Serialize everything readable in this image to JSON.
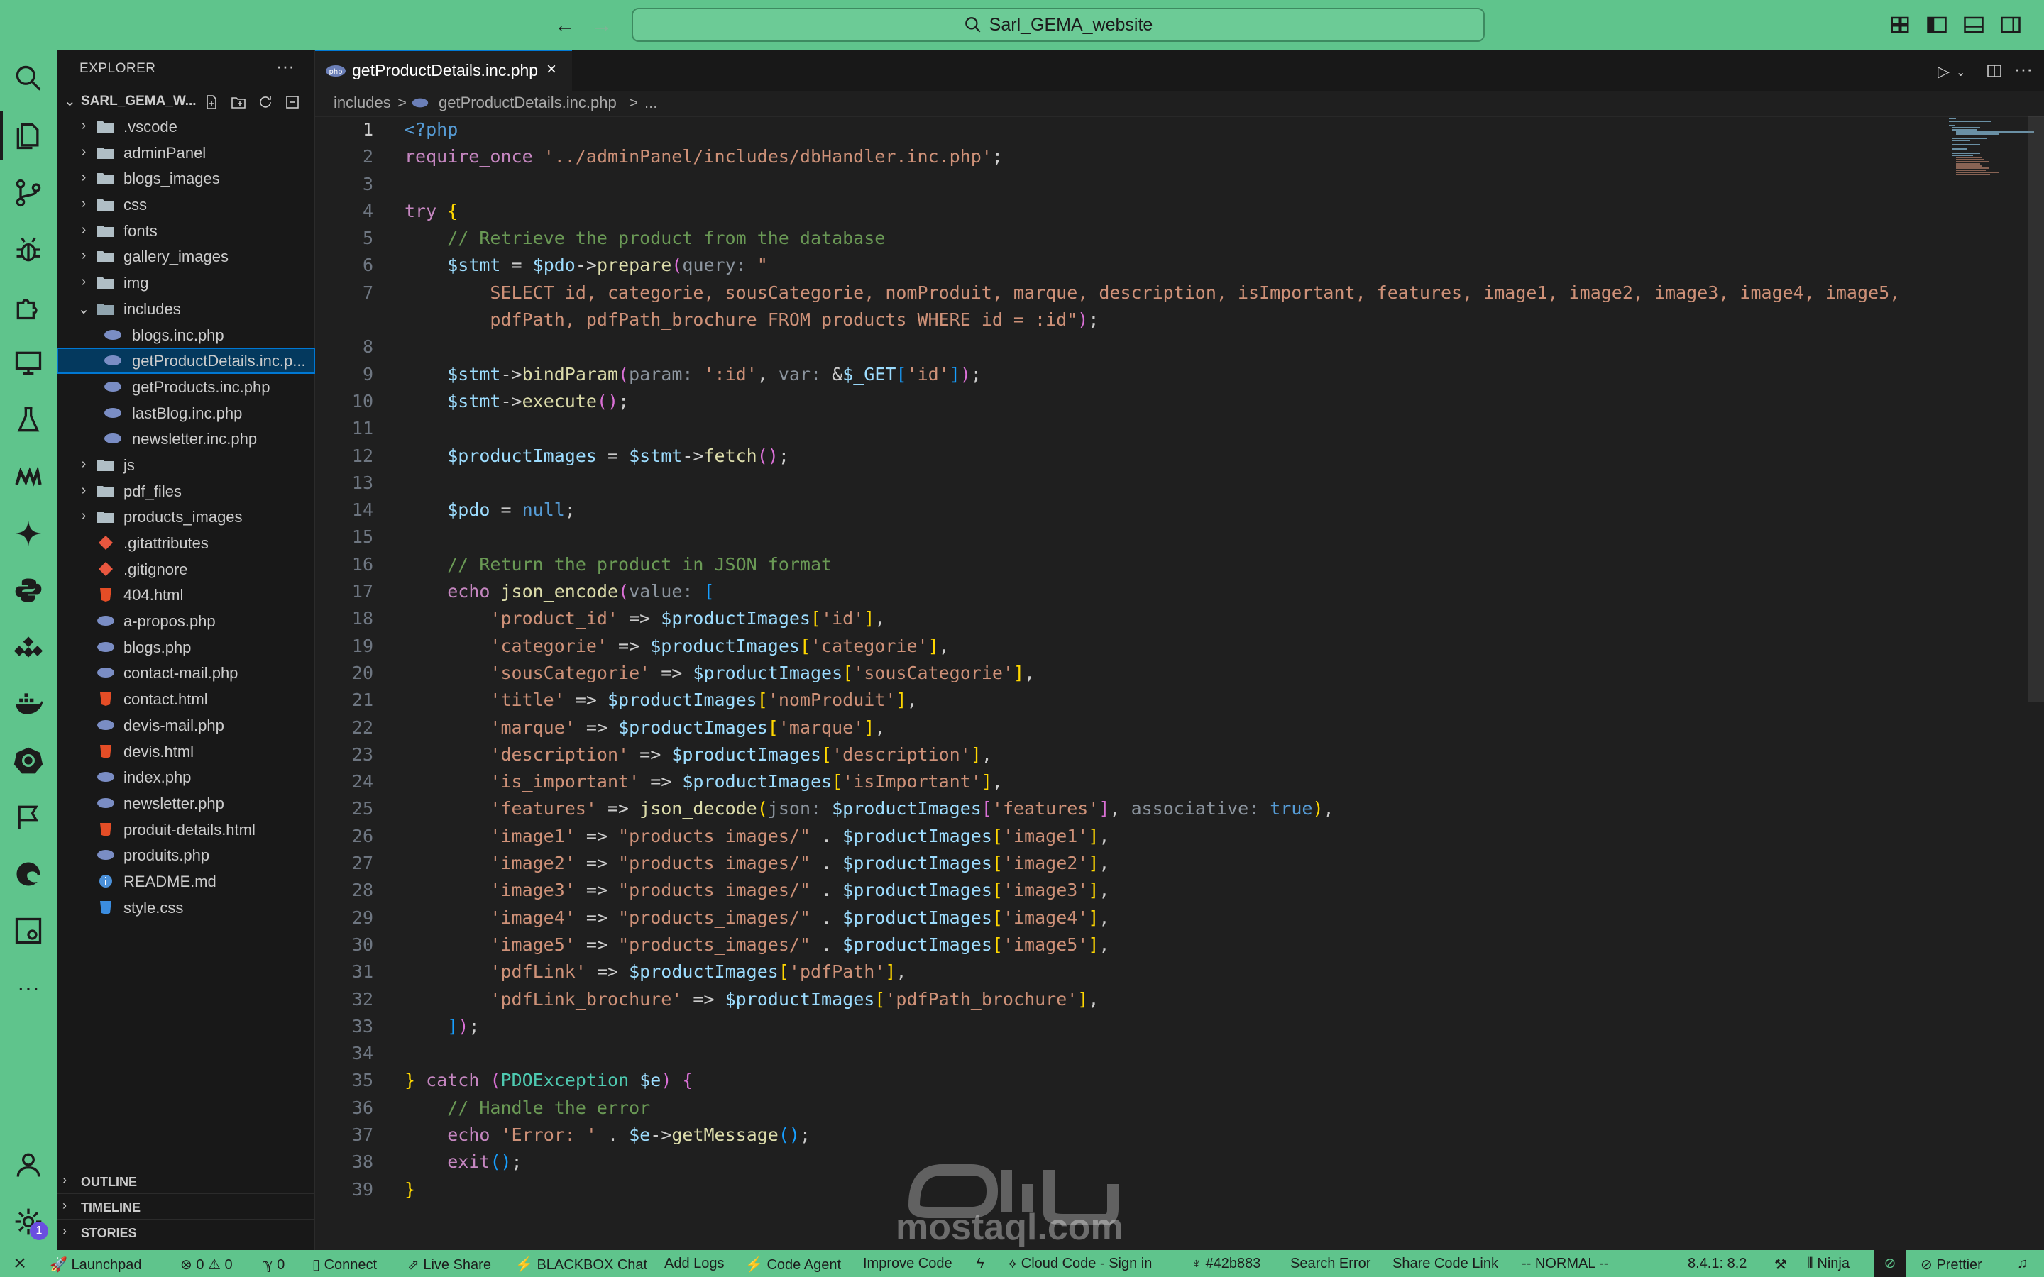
{
  "window": {
    "search_label": "Sarl_GEMA_website"
  },
  "sidebar": {
    "title": "EXPLORER",
    "root_label": "SARL_GEMA_W...",
    "tree": [
      {
        "label": ".vscode",
        "type": "folder"
      },
      {
        "label": "adminPanel",
        "type": "folder"
      },
      {
        "label": "blogs_images",
        "type": "folder"
      },
      {
        "label": "css",
        "type": "folder"
      },
      {
        "label": "fonts",
        "type": "folder"
      },
      {
        "label": "gallery_images",
        "type": "folder"
      },
      {
        "label": "img",
        "type": "folder"
      },
      {
        "label": "includes",
        "type": "folder-open"
      },
      {
        "label": "blogs.inc.php",
        "type": "php"
      },
      {
        "label": "getProductDetails.inc.p...",
        "type": "php",
        "selected": true
      },
      {
        "label": "getProducts.inc.php",
        "type": "php"
      },
      {
        "label": "lastBlog.inc.php",
        "type": "php"
      },
      {
        "label": "newsletter.inc.php",
        "type": "php"
      },
      {
        "label": "js",
        "type": "folder"
      },
      {
        "label": "pdf_files",
        "type": "folder"
      },
      {
        "label": "products_images",
        "type": "folder"
      },
      {
        "label": ".gitattributes",
        "type": "git"
      },
      {
        "label": ".gitignore",
        "type": "git"
      },
      {
        "label": "404.html",
        "type": "html"
      },
      {
        "label": "a-propos.php",
        "type": "php"
      },
      {
        "label": "blogs.php",
        "type": "php"
      },
      {
        "label": "contact-mail.php",
        "type": "php"
      },
      {
        "label": "contact.html",
        "type": "html"
      },
      {
        "label": "devis-mail.php",
        "type": "php"
      },
      {
        "label": "devis.html",
        "type": "html"
      },
      {
        "label": "index.php",
        "type": "php"
      },
      {
        "label": "newsletter.php",
        "type": "php"
      },
      {
        "label": "produit-details.html",
        "type": "html"
      },
      {
        "label": "produits.php",
        "type": "php"
      },
      {
        "label": "README.md",
        "type": "info"
      },
      {
        "label": "style.css",
        "type": "css"
      }
    ],
    "sections": [
      "OUTLINE",
      "TIMELINE",
      "STORIES"
    ]
  },
  "editor": {
    "tab_label": "getProductDetails.inc.php",
    "tab_close": "×",
    "breadcrumbs": [
      "includes",
      ">",
      "getProductDetails.inc.php",
      ">",
      "..."
    ]
  },
  "watermark": "mostaql.com",
  "statusbar": {
    "items": [
      "Launchpad",
      "0",
      "0",
      "0",
      "Connect",
      "Live Share",
      "BLACKBOX Chat",
      "Add Logs",
      "Code Agent",
      "Improve Code",
      "Cloud Code - Sign in",
      "#42b883",
      "Search Error",
      "Share Code Link",
      "-- NORMAL --",
      "8.4.1: 8.2",
      "Ninja",
      "Prettier"
    ]
  }
}
